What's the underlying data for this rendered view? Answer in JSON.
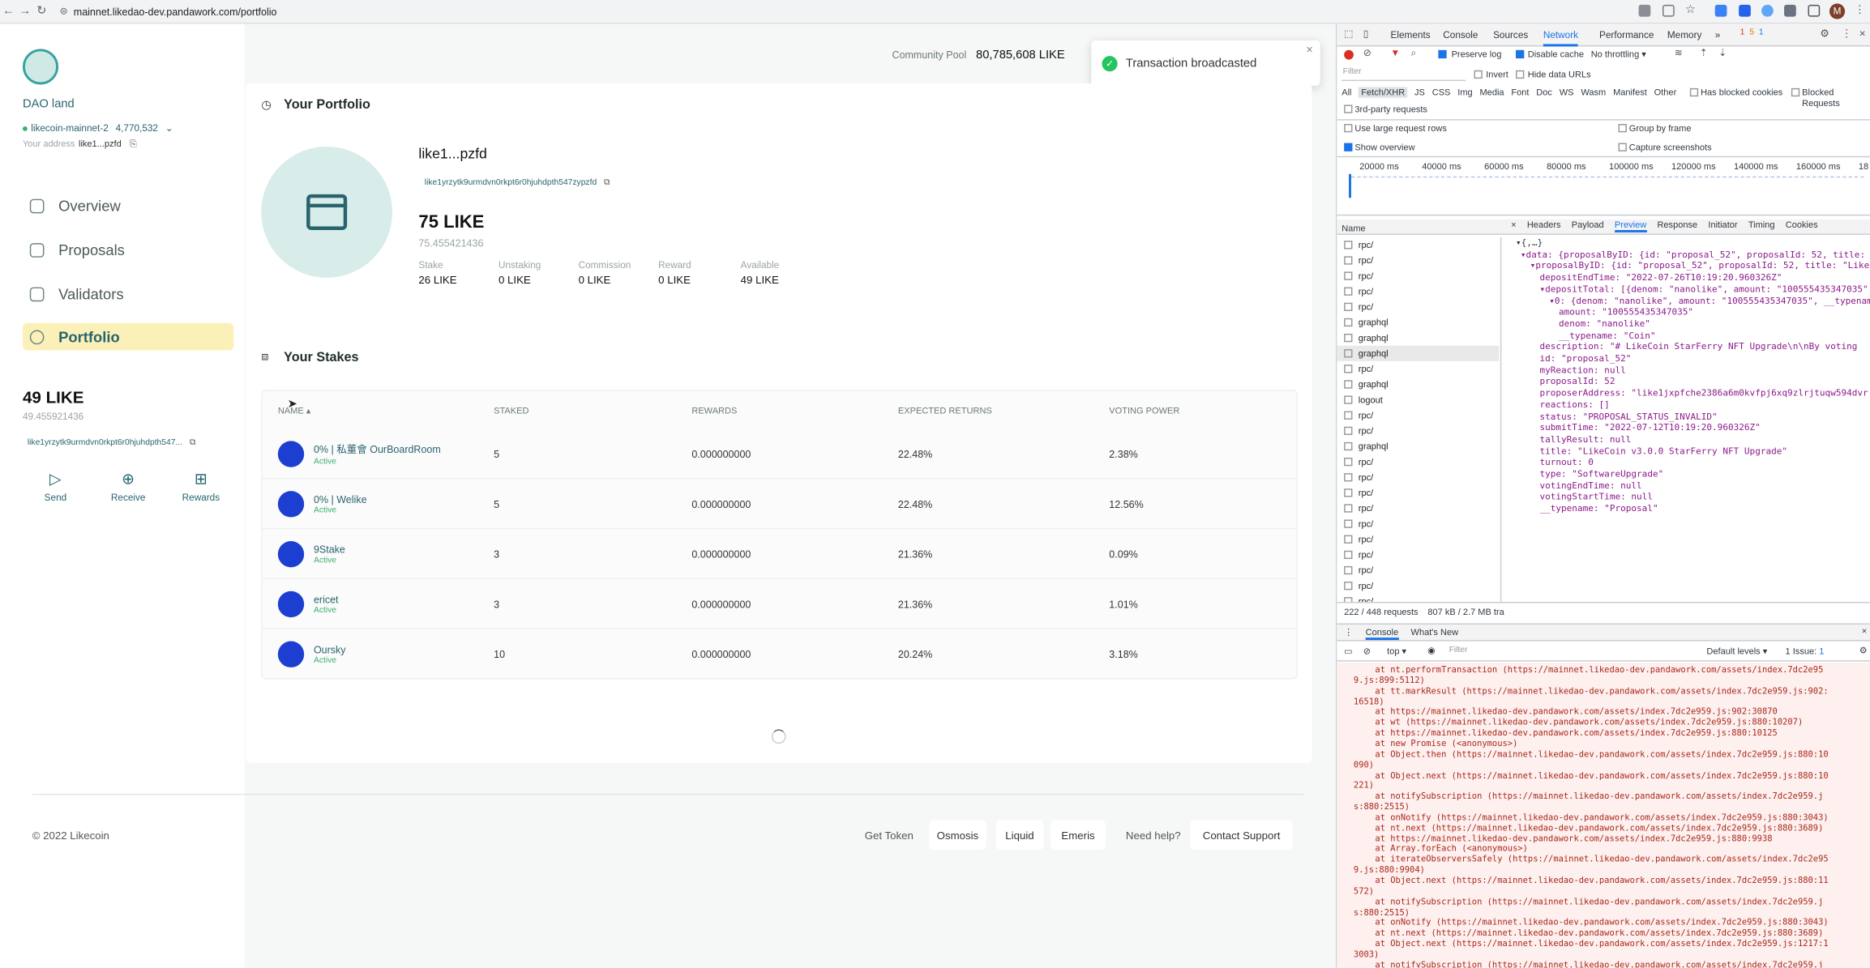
{
  "browser": {
    "url": "mainnet.likedao-dev.pandawork.com/portfolio"
  },
  "sidebar": {
    "brand": "DAO land",
    "chain": "likecoin-mainnet-2",
    "block": "4,770,532",
    "address_label": "Your address",
    "address": "like1...pzfd",
    "nav": [
      {
        "label": "Overview"
      },
      {
        "label": "Proposals"
      },
      {
        "label": "Validators"
      },
      {
        "label": "Portfolio"
      }
    ],
    "balance": "49 LIKE",
    "balance_precise": "49.455921436",
    "full_address": "like1yrzytk9urmdvn0rkpt6r0hjuhdpth547...",
    "actions": [
      {
        "label": "Send"
      },
      {
        "label": "Receive"
      },
      {
        "label": "Rewards"
      }
    ]
  },
  "header": {
    "pool_label": "Community Pool",
    "pool_value": "80,785,608 LIKE"
  },
  "toast": {
    "message": "Transaction broadcasted"
  },
  "portfolio": {
    "title": "Your Portfolio",
    "short_address": "like1...pzfd",
    "address": "like1yrzytk9urmdvn0rkpt6r0hjuhdpth547zypzfd",
    "total": "75 LIKE",
    "total_precise": "75.455421436",
    "stats": [
      {
        "label": "Stake",
        "value": "26 LIKE"
      },
      {
        "label": "Unstaking",
        "value": "0 LIKE"
      },
      {
        "label": "Commission",
        "value": "0 LIKE"
      },
      {
        "label": "Reward",
        "value": "0 LIKE"
      },
      {
        "label": "Available",
        "value": "49 LIKE"
      }
    ]
  },
  "stakes": {
    "title": "Your Stakes",
    "columns": [
      "NAME",
      "STAKED",
      "REWARDS",
      "EXPECTED RETURNS",
      "VOTING POWER"
    ],
    "rows": [
      {
        "name": "0% | 私董會 OurBoardRoom",
        "status": "Active",
        "staked": "5",
        "rewards": "0.000000000",
        "returns": "22.48%",
        "power": "2.38%"
      },
      {
        "name": "0% | Welike",
        "status": "Active",
        "staked": "5",
        "rewards": "0.000000000",
        "returns": "22.48%",
        "power": "12.56%"
      },
      {
        "name": "9Stake",
        "status": "Active",
        "staked": "3",
        "rewards": "0.000000000",
        "returns": "21.36%",
        "power": "0.09%"
      },
      {
        "name": "ericet",
        "status": "Active",
        "staked": "3",
        "rewards": "0.000000000",
        "returns": "21.36%",
        "power": "1.01%"
      },
      {
        "name": "Oursky",
        "status": "Active",
        "staked": "10",
        "rewards": "0.000000000",
        "returns": "20.24%",
        "power": "3.18%"
      }
    ]
  },
  "footer": {
    "copyright": "© 2022 Likecoin",
    "get_token": "Get Token",
    "links": [
      "Osmosis",
      "Liquid",
      "Emeris"
    ],
    "help": "Need help?",
    "support": "Contact Support"
  },
  "devtools": {
    "tabs": [
      "Elements",
      "Console",
      "Sources",
      "Network",
      "Performance",
      "Memory",
      "»"
    ],
    "counts": {
      "errors": "1",
      "warnings": "5",
      "messages": "1"
    },
    "toolbar": {
      "preserve_log": "Preserve log",
      "disable_cache": "Disable cache",
      "throttle": "No throttling"
    },
    "filter_placeholder": "Filter",
    "invert": "Invert",
    "hide_data": "Hide data URLs",
    "types": [
      "All",
      "Fetch/XHR",
      "JS",
      "CSS",
      "Img",
      "Media",
      "Font",
      "Doc",
      "WS",
      "Wasm",
      "Manifest",
      "Other"
    ],
    "blocked_cookies": "Has blocked cookies",
    "blocked_requests": "Blocked Requests",
    "third_party": "3rd-party requests",
    "large_rows": "Use large request rows",
    "group_by_frame": "Group by frame",
    "show_overview": "Show overview",
    "capture_screenshots": "Capture screenshots",
    "timeline": [
      "20000 ms",
      "40000 ms",
      "60000 ms",
      "80000 ms",
      "100000 ms",
      "120000 ms",
      "140000 ms",
      "160000 ms",
      "18"
    ],
    "name_header": "Name",
    "requests": [
      "rpc/",
      "rpc/",
      "rpc/",
      "rpc/",
      "rpc/",
      "graphql",
      "graphql",
      "graphql",
      "rpc/",
      "graphql",
      "logout",
      "rpc/",
      "rpc/",
      "graphql",
      "rpc/",
      "rpc/",
      "rpc/",
      "rpc/",
      "rpc/",
      "rpc/",
      "rpc/",
      "rpc/",
      "rpc/",
      "rpc/"
    ],
    "detail_tabs": [
      "×",
      "Headers",
      "Payload",
      "Preview",
      "Response",
      "Initiator",
      "Timing",
      "Cookies"
    ],
    "summary": "222 / 448 requests",
    "transfer": "807 kB / 2.7 MB tra",
    "preview": [
      "▾{,…}",
      "▾data: {proposalByID: {id: \"proposal_52\", proposalId: 52, title:",
      "▾proposalByID: {id: \"proposal_52\", proposalId: 52, title: \"Like",
      "depositEndTime: \"2022-07-26T10:19:20.960326Z\"",
      "▾depositTotal: [{denom: \"nanolike\", amount: \"100555435347035\"",
      "▾0: {denom: \"nanolike\", amount: \"100555435347035\", __typenam",
      "amount: \"100555435347035\"",
      "denom: \"nanolike\"",
      "__typename: \"Coin\"",
      "description: \"# LikeCoin StarFerry NFT Upgrade\\n\\nBy voting",
      "id: \"proposal_52\"",
      "myReaction: null",
      "proposalId: 52",
      "proposerAddress: \"like1jxpfche2386a6m0kvfpj6xq9zlrjtuqw594dvr",
      "reactions: []",
      "status: \"PROPOSAL_STATUS_INVALID\"",
      "submitTime: \"2022-07-12T10:19:20.960326Z\"",
      "tallyResult: null",
      "title: \"LikeCoin v3.0.0 StarFerry NFT Upgrade\"",
      "turnout: 0",
      "type: \"SoftwareUpgrade\"",
      "votingEndTime: null",
      "votingStartTime: null",
      "__typename: \"Proposal\""
    ],
    "console_tabs": [
      "Console",
      "What's New"
    ],
    "console_filter": "Filter",
    "context": "top",
    "levels": "Default levels",
    "issues": "1 Issue:",
    "errors": [
      "at nt.performTransaction (https://mainnet.likedao-dev.pandawork.com/assets/index.7dc2e95",
      "9.js:899:5112)",
      "at tt.markResult (https://mainnet.likedao-dev.pandawork.com/assets/index.7dc2e959.js:902:",
      "16518)",
      "at https://mainnet.likedao-dev.pandawork.com/assets/index.7dc2e959.js:902:30870",
      "at wt (https://mainnet.likedao-dev.pandawork.com/assets/index.7dc2e959.js:880:10207)",
      "at https://mainnet.likedao-dev.pandawork.com/assets/index.7dc2e959.js:880:10125",
      "at new Promise (<anonymous>)",
      "at Object.then (https://mainnet.likedao-dev.pandawork.com/assets/index.7dc2e959.js:880:10",
      "090)",
      "at Object.next (https://mainnet.likedao-dev.pandawork.com/assets/index.7dc2e959.js:880:10",
      "221)",
      "at notifySubscription (https://mainnet.likedao-dev.pandawork.com/assets/index.7dc2e959.j",
      "s:880:2515)",
      "at onNotify (https://mainnet.likedao-dev.pandawork.com/assets/index.7dc2e959.js:880:3043)",
      "at nt.next (https://mainnet.likedao-dev.pandawork.com/assets/index.7dc2e959.js:880:3689)",
      "at https://mainnet.likedao-dev.pandawork.com/assets/index.7dc2e959.js:880:9938",
      "at Array.forEach (<anonymous>)",
      "at iterateObserversSafely (https://mainnet.likedao-dev.pandawork.com/assets/index.7dc2e95",
      "9.js:880:9904)",
      "at Object.next (https://mainnet.likedao-dev.pandawork.com/assets/index.7dc2e959.js:880:11",
      "572)",
      "at notifySubscription (https://mainnet.likedao-dev.pandawork.com/assets/index.7dc2e959.j",
      "s:880:2515)",
      "at onNotify (https://mainnet.likedao-dev.pandawork.com/assets/index.7dc2e959.js:880:3043)",
      "at nt.next (https://mainnet.likedao-dev.pandawork.com/assets/index.7dc2e959.js:880:3689)",
      "at Object.next (https://mainnet.likedao-dev.pandawork.com/assets/index.7dc2e959.js:1217:1",
      "3003)",
      "at notifySubscription (https://mainnet.likedao-dev.pandawork.com/assets/index.7dc2e959.j"
    ]
  }
}
